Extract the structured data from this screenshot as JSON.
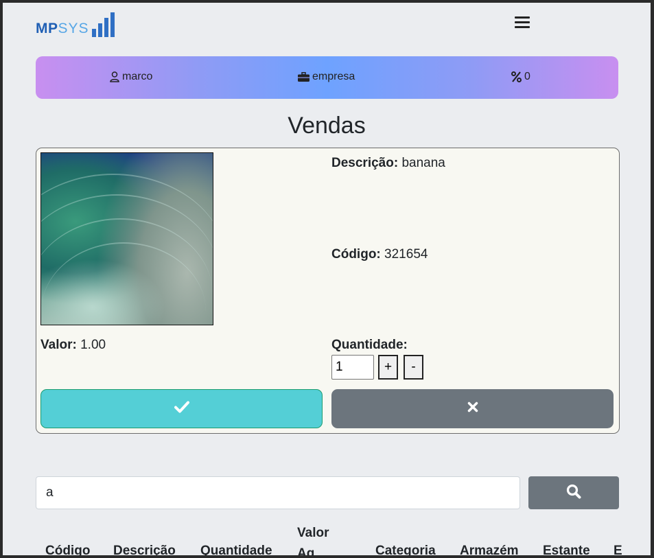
{
  "brand": {
    "part1": "MP",
    "part2": "SYS",
    "logo_bar_heights": [
      0.35,
      0.55,
      0.75,
      1.0
    ]
  },
  "menu": {
    "icon": "hamburger-icon"
  },
  "infobar": {
    "user": {
      "icon": "user-icon",
      "text": "marco"
    },
    "company": {
      "icon": "briefcase-icon",
      "text": "empresa"
    },
    "discount": {
      "icon": "percent-icon",
      "text": "0"
    }
  },
  "page": {
    "title": "Vendas"
  },
  "product": {
    "image_icon": "product-image",
    "valor_label": "Valor:",
    "valor": "1.00",
    "descricao_label": "Descrição:",
    "descricao": "banana",
    "codigo_label": "Código:",
    "codigo": "321654",
    "quantidade_label": "Quantidade:",
    "quantidade": "1",
    "plus_label": "+",
    "minus_label": "-",
    "confirm_icon": "check-icon",
    "cancel_icon": "close-icon"
  },
  "search": {
    "value": "a",
    "button_icon": "search-icon"
  },
  "table": {
    "headers": [
      "Código",
      "Descrição",
      "Quantidade",
      "Valor Aq.",
      "Categoria",
      "Armazém",
      "Estante",
      "E"
    ]
  },
  "colors": {
    "confirm": "#54cfd6",
    "secondary": "#6c757d",
    "page_bg": "#ebedf0",
    "card_bg": "#f8f8f2"
  }
}
